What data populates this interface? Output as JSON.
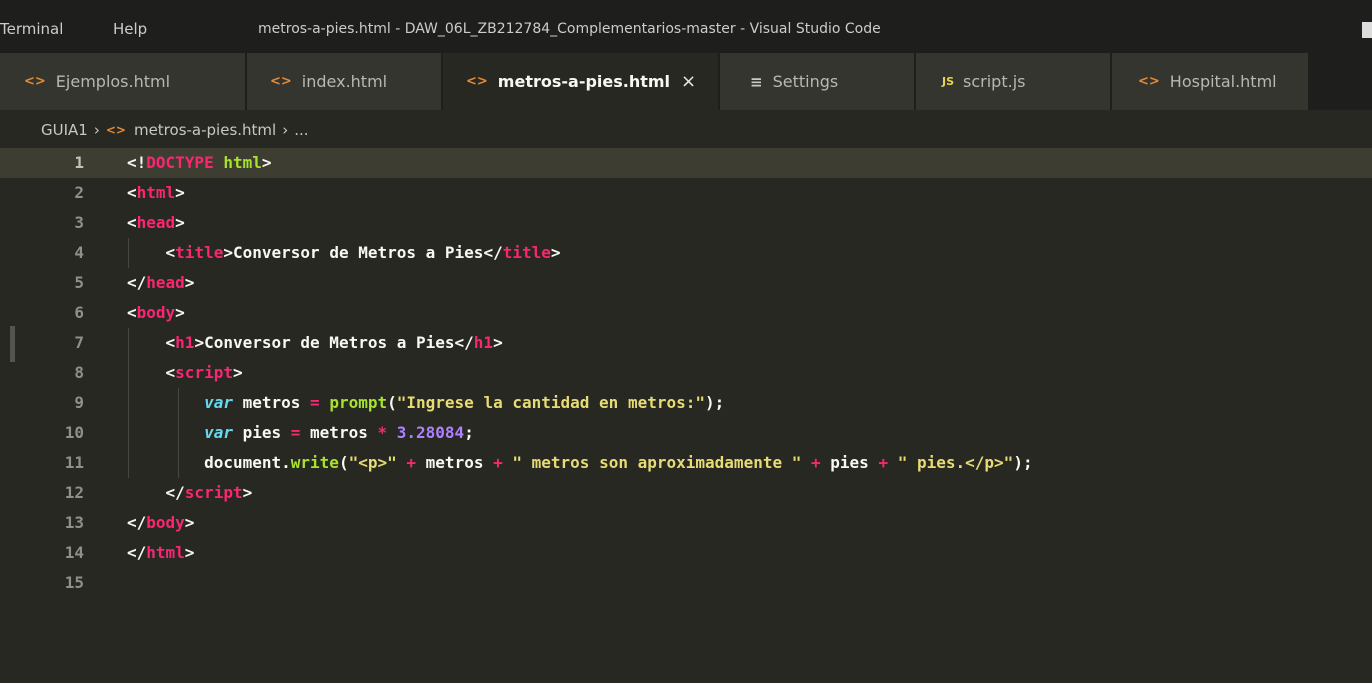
{
  "menu": {
    "terminal": "Terminal",
    "help": "Help"
  },
  "window_title": "metros-a-pies.html - DAW_06L_ZB212784_Complementarios-master - Visual Studio Code",
  "tabs": [
    {
      "label": "Ejemplos.html",
      "icon": "html-file-icon",
      "glyph": "<>"
    },
    {
      "label": "index.html",
      "icon": "html-file-icon",
      "glyph": "<>"
    },
    {
      "label": "metros-a-pies.html",
      "icon": "html-file-icon",
      "glyph": "<>",
      "active": true,
      "close": "×"
    },
    {
      "label": "Settings",
      "icon": "settings-icon",
      "glyph": "≡"
    },
    {
      "label": "script.js",
      "icon": "js-file-icon",
      "glyph": "JS"
    },
    {
      "label": "Hospital.html",
      "icon": "html-file-icon",
      "glyph": "<>"
    }
  ],
  "breadcrumb": {
    "folder": "GUIA1",
    "sep": "›",
    "file_glyph": "<>",
    "file": "metros-a-pies.html",
    "ellipsis": "..."
  },
  "editor": {
    "current_line": 1,
    "lines": [
      {
        "n": "1",
        "tokens": [
          [
            "t-punc",
            "<!"
          ],
          [
            "t-tag",
            "DOCTYPE"
          ],
          [
            "t-text",
            " "
          ],
          [
            "t-attr",
            "html"
          ],
          [
            "t-punc",
            ">"
          ]
        ]
      },
      {
        "n": "2",
        "tokens": [
          [
            "t-punc",
            "<"
          ],
          [
            "t-tag",
            "html"
          ],
          [
            "t-punc",
            ">"
          ]
        ]
      },
      {
        "n": "3",
        "tokens": [
          [
            "t-punc",
            "<"
          ],
          [
            "t-tag",
            "head"
          ],
          [
            "t-punc",
            ">"
          ]
        ]
      },
      {
        "n": "4",
        "tokens": [
          [
            "t-text",
            "    "
          ],
          [
            "t-punc",
            "<"
          ],
          [
            "t-tag",
            "title"
          ],
          [
            "t-punc",
            ">"
          ],
          [
            "t-text",
            "Conversor de Metros a Pies"
          ],
          [
            "t-punc",
            "</"
          ],
          [
            "t-tag",
            "title"
          ],
          [
            "t-punc",
            ">"
          ]
        ]
      },
      {
        "n": "5",
        "tokens": [
          [
            "t-punc",
            "</"
          ],
          [
            "t-tag",
            "head"
          ],
          [
            "t-punc",
            ">"
          ]
        ]
      },
      {
        "n": "6",
        "tokens": [
          [
            "t-punc",
            "<"
          ],
          [
            "t-tag",
            "body"
          ],
          [
            "t-punc",
            ">"
          ]
        ]
      },
      {
        "n": "7",
        "tokens": [
          [
            "t-text",
            "    "
          ],
          [
            "t-punc",
            "<"
          ],
          [
            "t-tag",
            "h1"
          ],
          [
            "t-punc",
            ">"
          ],
          [
            "t-text",
            "Conversor de Metros a Pies"
          ],
          [
            "t-punc",
            "</"
          ],
          [
            "t-tag",
            "h1"
          ],
          [
            "t-punc",
            ">"
          ]
        ]
      },
      {
        "n": "8",
        "tokens": [
          [
            "t-text",
            "    "
          ],
          [
            "t-punc",
            "<"
          ],
          [
            "t-tag",
            "script"
          ],
          [
            "t-punc",
            ">"
          ]
        ]
      },
      {
        "n": "9",
        "tokens": [
          [
            "t-text",
            "        "
          ],
          [
            "t-kw",
            "var"
          ],
          [
            "t-text",
            " metros "
          ],
          [
            "t-op",
            "="
          ],
          [
            "t-text",
            " "
          ],
          [
            "t-fn",
            "prompt"
          ],
          [
            "t-text",
            "("
          ],
          [
            "t-str",
            "\"Ingrese la cantidad en metros:\""
          ],
          [
            "t-text",
            ");"
          ]
        ]
      },
      {
        "n": "10",
        "tokens": [
          [
            "t-text",
            "        "
          ],
          [
            "t-kw",
            "var"
          ],
          [
            "t-text",
            " pies "
          ],
          [
            "t-op",
            "="
          ],
          [
            "t-text",
            " metros "
          ],
          [
            "t-op",
            "*"
          ],
          [
            "t-text",
            " "
          ],
          [
            "t-num",
            "3.28084"
          ],
          [
            "t-text",
            ";"
          ]
        ]
      },
      {
        "n": "11",
        "tokens": [
          [
            "t-text",
            "        document."
          ],
          [
            "t-fn",
            "write"
          ],
          [
            "t-text",
            "("
          ],
          [
            "t-str",
            "\"<p>\""
          ],
          [
            "t-text",
            " "
          ],
          [
            "t-op",
            "+"
          ],
          [
            "t-text",
            " metros "
          ],
          [
            "t-op",
            "+"
          ],
          [
            "t-text",
            " "
          ],
          [
            "t-str",
            "\" metros son aproximadamente \""
          ],
          [
            "t-text",
            " "
          ],
          [
            "t-op",
            "+"
          ],
          [
            "t-text",
            " pies "
          ],
          [
            "t-op",
            "+"
          ],
          [
            "t-text",
            " "
          ],
          [
            "t-str",
            "\" pies.</p>\""
          ],
          [
            "t-text",
            ");"
          ]
        ]
      },
      {
        "n": "12",
        "tokens": [
          [
            "t-text",
            "    "
          ],
          [
            "t-punc",
            "</"
          ],
          [
            "t-tag",
            "script"
          ],
          [
            "t-punc",
            ">"
          ]
        ]
      },
      {
        "n": "13",
        "tokens": [
          [
            "t-punc",
            "</"
          ],
          [
            "t-tag",
            "body"
          ],
          [
            "t-punc",
            ">"
          ]
        ]
      },
      {
        "n": "14",
        "tokens": [
          [
            "t-punc",
            "</"
          ],
          [
            "t-tag",
            "html"
          ],
          [
            "t-punc",
            ">"
          ]
        ]
      },
      {
        "n": "15",
        "tokens": []
      }
    ]
  },
  "colors": {
    "editor_bg": "#272822",
    "tag": "#f92672",
    "keyword": "#66d9ef",
    "function": "#a6e22e",
    "string": "#e6db74",
    "number": "#ae81ff"
  }
}
